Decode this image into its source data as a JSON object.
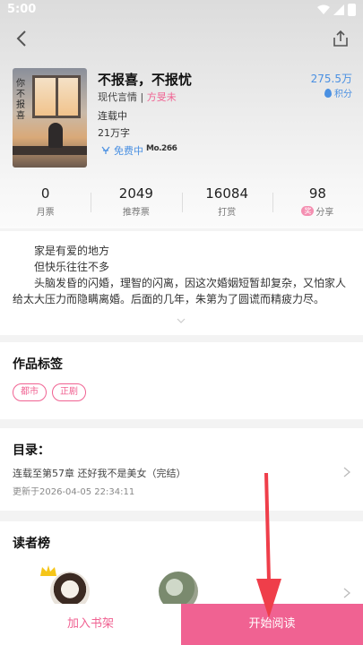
{
  "status": {
    "time": "5:00"
  },
  "book": {
    "title": "不报喜，不报忧",
    "genre": "现代言情",
    "separator": " | ",
    "author": "方旻未",
    "status": "连载中",
    "word_count": "21万字",
    "free_label": "免费中",
    "badge_text": "Mo.266",
    "views": "275.5万",
    "points_label": "积分",
    "cover_text": "你不报喜"
  },
  "stats": [
    {
      "value": "0",
      "label": "月票"
    },
    {
      "value": "2049",
      "label": "推荐票"
    },
    {
      "value": "16084",
      "label": "打赏"
    },
    {
      "value": "98",
      "label": "分享",
      "tag": "奖"
    }
  ],
  "description": {
    "line1": "家是有爱的地方",
    "line2": "但快乐往往不多",
    "line3": "头脑发昏的闪婚，理智的闪离，因这次婚姻短暂却复杂，又怕家人给太大压力而隐瞒离婚。后面的几年，朱第为了圆谎而精疲力尽。"
  },
  "tags_section": {
    "title": "作品标签",
    "tags": [
      "都市",
      "正剧"
    ]
  },
  "toc": {
    "title": "目录：",
    "latest": "连载至第57章 还好我不是美女（完结）",
    "updated": "更新于2026-04-05 22:34:11"
  },
  "readers": {
    "title": "读者榜"
  },
  "bottom": {
    "add_shelf": "加入书架",
    "start_read": "开始阅读"
  },
  "colors": {
    "accent": "#f06292",
    "blue": "#4a90e2"
  }
}
